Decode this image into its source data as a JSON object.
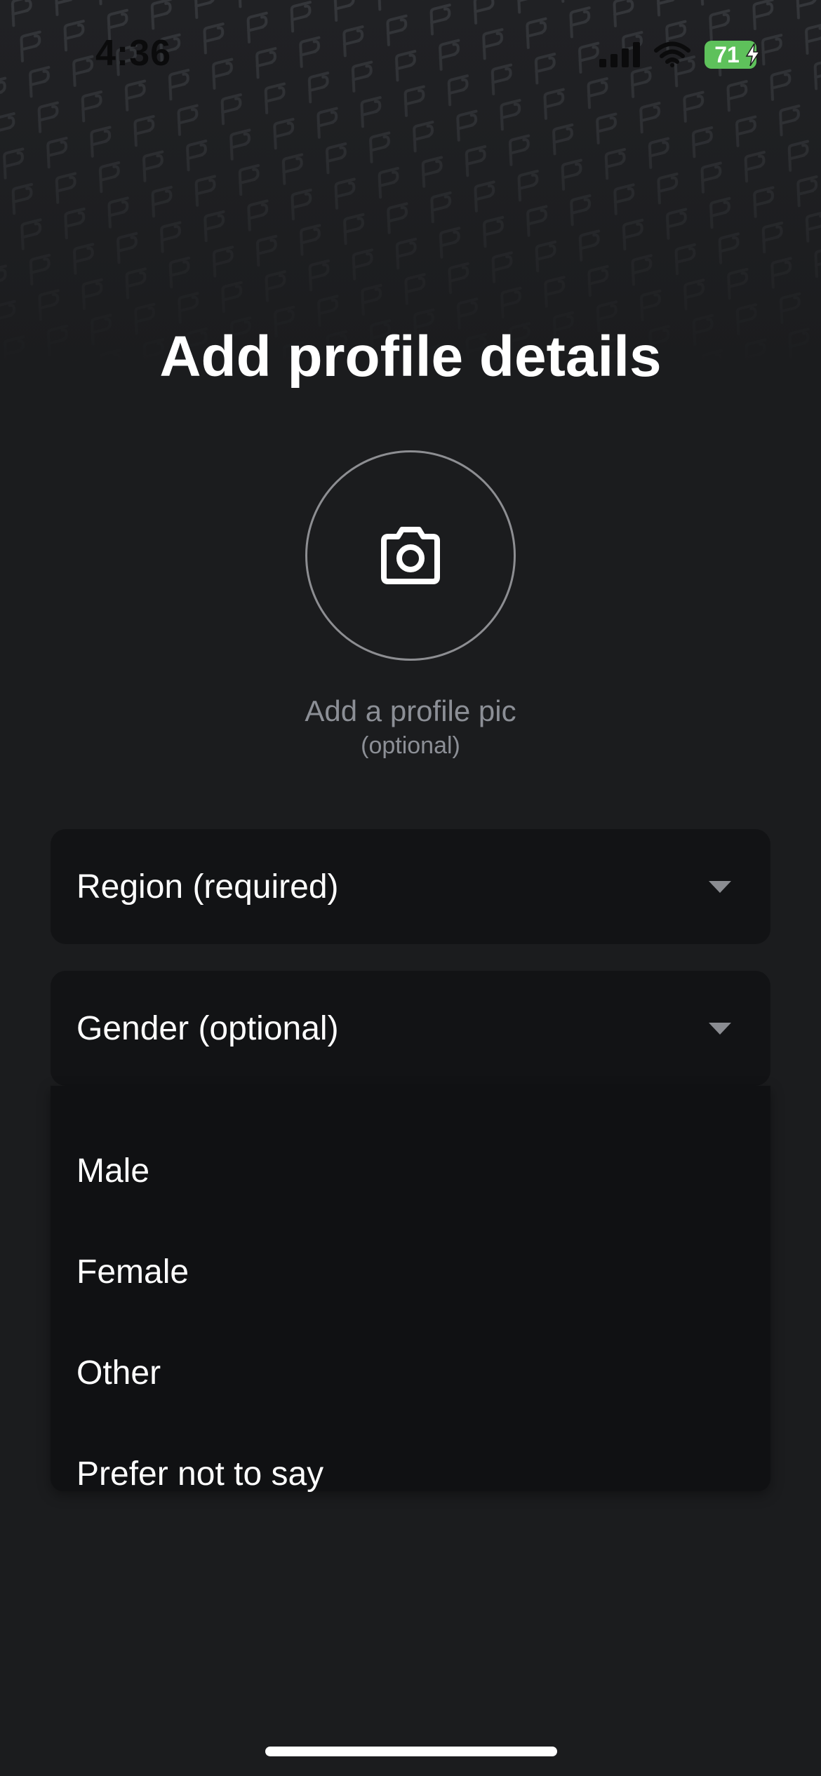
{
  "status_bar": {
    "time": "4:36",
    "battery_level": "71",
    "icons": [
      "signal-icon",
      "wifi-icon",
      "battery-icon"
    ]
  },
  "page": {
    "title": "Add profile details",
    "profile_pic": {
      "icon": "camera-icon",
      "label": "Add a profile pic",
      "sublabel": "(optional)"
    }
  },
  "fields": {
    "region": {
      "placeholder": "Region (required)",
      "icon": "caret-down-icon"
    },
    "gender": {
      "placeholder": "Gender (optional)",
      "icon": "caret-down-icon"
    }
  },
  "gender_options": [
    {
      "label": "Male"
    },
    {
      "label": "Female"
    },
    {
      "label": "Other"
    },
    {
      "label": "Prefer not to say"
    }
  ],
  "colors": {
    "background": "#1b1c1e",
    "field_background": "#121315",
    "muted_text": "#8c8f96",
    "battery_green": "#5ec15b"
  }
}
